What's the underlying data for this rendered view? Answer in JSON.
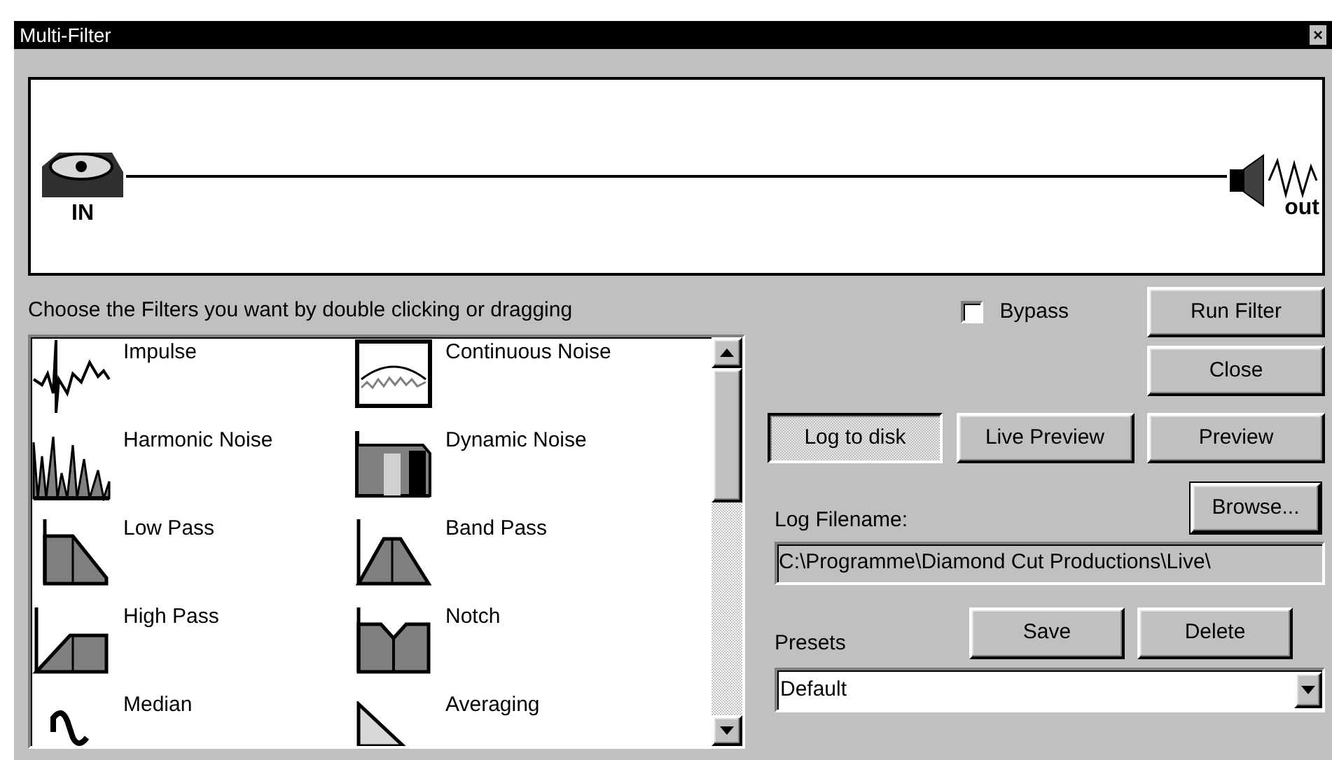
{
  "window": {
    "title": "Multi-Filter",
    "close": "×"
  },
  "chain": {
    "input_label": "IN",
    "output_label": "out"
  },
  "instructions": "Choose the Filters you want by double clicking or dragging",
  "filters": [
    {
      "name": "Impulse",
      "kind": "impulse"
    },
    {
      "name": "Continuous Noise",
      "kind": "continuous"
    },
    {
      "name": "Harmonic Noise",
      "kind": "harmonic"
    },
    {
      "name": "Dynamic Noise",
      "kind": "dynamic"
    },
    {
      "name": "Low Pass",
      "kind": "lowpass"
    },
    {
      "name": "Band Pass",
      "kind": "bandpass"
    },
    {
      "name": "High Pass",
      "kind": "highpass"
    },
    {
      "name": "Notch",
      "kind": "notch"
    },
    {
      "name": "Median",
      "kind": "median"
    },
    {
      "name": "Averaging",
      "kind": "averaging"
    }
  ],
  "bypass": {
    "label": "Bypass",
    "checked": false
  },
  "buttons": {
    "run": "Run Filter",
    "close": "Close",
    "log": {
      "label": "Log to disk",
      "selected": true
    },
    "live_preview": "Live Preview",
    "preview": "Preview",
    "browse": "Browse...",
    "save": "Save",
    "delete": "Delete"
  },
  "log_filename": {
    "label": "Log Filename:",
    "value": "C:\\Programme\\Diamond Cut Productions\\Live\\"
  },
  "presets": {
    "label": "Presets",
    "value": "Default"
  }
}
